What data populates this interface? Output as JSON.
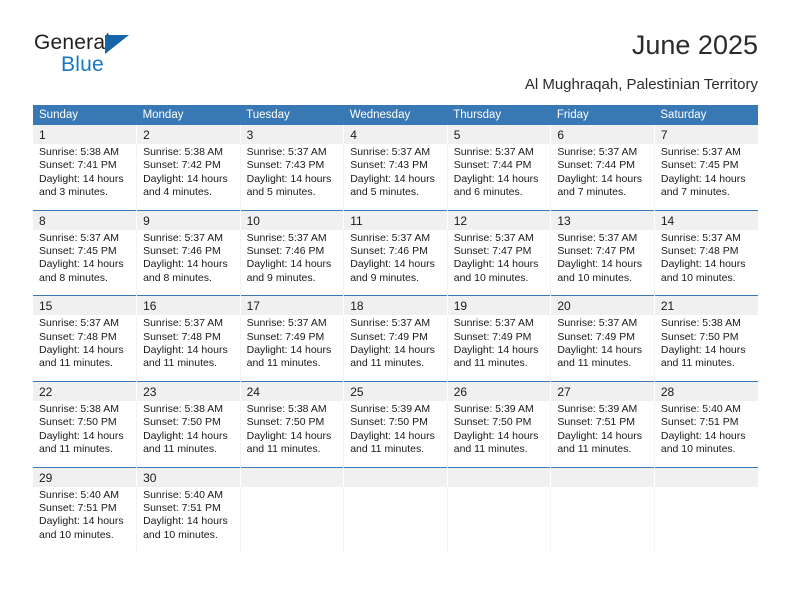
{
  "brand": {
    "name_top": "General",
    "name_bottom": "Blue",
    "accent_color": "#1778c2",
    "triangle_color": "#1565a8"
  },
  "header": {
    "title": "June 2025",
    "subtitle": "Al Mughraqah, Palestinian Territory"
  },
  "calendar": {
    "header_bg": "#3878b4",
    "daynum_bg": "#f0f0f0",
    "weekday_headers": [
      "Sunday",
      "Monday",
      "Tuesday",
      "Wednesday",
      "Thursday",
      "Friday",
      "Saturday"
    ],
    "weeks": [
      [
        {
          "day": "1",
          "sunrise": "Sunrise: 5:38 AM",
          "sunset": "Sunset: 7:41 PM",
          "daylight_1": "Daylight: 14 hours",
          "daylight_2": "and 3 minutes."
        },
        {
          "day": "2",
          "sunrise": "Sunrise: 5:38 AM",
          "sunset": "Sunset: 7:42 PM",
          "daylight_1": "Daylight: 14 hours",
          "daylight_2": "and 4 minutes."
        },
        {
          "day": "3",
          "sunrise": "Sunrise: 5:37 AM",
          "sunset": "Sunset: 7:43 PM",
          "daylight_1": "Daylight: 14 hours",
          "daylight_2": "and 5 minutes."
        },
        {
          "day": "4",
          "sunrise": "Sunrise: 5:37 AM",
          "sunset": "Sunset: 7:43 PM",
          "daylight_1": "Daylight: 14 hours",
          "daylight_2": "and 5 minutes."
        },
        {
          "day": "5",
          "sunrise": "Sunrise: 5:37 AM",
          "sunset": "Sunset: 7:44 PM",
          "daylight_1": "Daylight: 14 hours",
          "daylight_2": "and 6 minutes."
        },
        {
          "day": "6",
          "sunrise": "Sunrise: 5:37 AM",
          "sunset": "Sunset: 7:44 PM",
          "daylight_1": "Daylight: 14 hours",
          "daylight_2": "and 7 minutes."
        },
        {
          "day": "7",
          "sunrise": "Sunrise: 5:37 AM",
          "sunset": "Sunset: 7:45 PM",
          "daylight_1": "Daylight: 14 hours",
          "daylight_2": "and 7 minutes."
        }
      ],
      [
        {
          "day": "8",
          "sunrise": "Sunrise: 5:37 AM",
          "sunset": "Sunset: 7:45 PM",
          "daylight_1": "Daylight: 14 hours",
          "daylight_2": "and 8 minutes."
        },
        {
          "day": "9",
          "sunrise": "Sunrise: 5:37 AM",
          "sunset": "Sunset: 7:46 PM",
          "daylight_1": "Daylight: 14 hours",
          "daylight_2": "and 8 minutes."
        },
        {
          "day": "10",
          "sunrise": "Sunrise: 5:37 AM",
          "sunset": "Sunset: 7:46 PM",
          "daylight_1": "Daylight: 14 hours",
          "daylight_2": "and 9 minutes."
        },
        {
          "day": "11",
          "sunrise": "Sunrise: 5:37 AM",
          "sunset": "Sunset: 7:46 PM",
          "daylight_1": "Daylight: 14 hours",
          "daylight_2": "and 9 minutes."
        },
        {
          "day": "12",
          "sunrise": "Sunrise: 5:37 AM",
          "sunset": "Sunset: 7:47 PM",
          "daylight_1": "Daylight: 14 hours",
          "daylight_2": "and 10 minutes."
        },
        {
          "day": "13",
          "sunrise": "Sunrise: 5:37 AM",
          "sunset": "Sunset: 7:47 PM",
          "daylight_1": "Daylight: 14 hours",
          "daylight_2": "and 10 minutes."
        },
        {
          "day": "14",
          "sunrise": "Sunrise: 5:37 AM",
          "sunset": "Sunset: 7:48 PM",
          "daylight_1": "Daylight: 14 hours",
          "daylight_2": "and 10 minutes."
        }
      ],
      [
        {
          "day": "15",
          "sunrise": "Sunrise: 5:37 AM",
          "sunset": "Sunset: 7:48 PM",
          "daylight_1": "Daylight: 14 hours",
          "daylight_2": "and 11 minutes."
        },
        {
          "day": "16",
          "sunrise": "Sunrise: 5:37 AM",
          "sunset": "Sunset: 7:48 PM",
          "daylight_1": "Daylight: 14 hours",
          "daylight_2": "and 11 minutes."
        },
        {
          "day": "17",
          "sunrise": "Sunrise: 5:37 AM",
          "sunset": "Sunset: 7:49 PM",
          "daylight_1": "Daylight: 14 hours",
          "daylight_2": "and 11 minutes."
        },
        {
          "day": "18",
          "sunrise": "Sunrise: 5:37 AM",
          "sunset": "Sunset: 7:49 PM",
          "daylight_1": "Daylight: 14 hours",
          "daylight_2": "and 11 minutes."
        },
        {
          "day": "19",
          "sunrise": "Sunrise: 5:37 AM",
          "sunset": "Sunset: 7:49 PM",
          "daylight_1": "Daylight: 14 hours",
          "daylight_2": "and 11 minutes."
        },
        {
          "day": "20",
          "sunrise": "Sunrise: 5:37 AM",
          "sunset": "Sunset: 7:49 PM",
          "daylight_1": "Daylight: 14 hours",
          "daylight_2": "and 11 minutes."
        },
        {
          "day": "21",
          "sunrise": "Sunrise: 5:38 AM",
          "sunset": "Sunset: 7:50 PM",
          "daylight_1": "Daylight: 14 hours",
          "daylight_2": "and 11 minutes."
        }
      ],
      [
        {
          "day": "22",
          "sunrise": "Sunrise: 5:38 AM",
          "sunset": "Sunset: 7:50 PM",
          "daylight_1": "Daylight: 14 hours",
          "daylight_2": "and 11 minutes."
        },
        {
          "day": "23",
          "sunrise": "Sunrise: 5:38 AM",
          "sunset": "Sunset: 7:50 PM",
          "daylight_1": "Daylight: 14 hours",
          "daylight_2": "and 11 minutes."
        },
        {
          "day": "24",
          "sunrise": "Sunrise: 5:38 AM",
          "sunset": "Sunset: 7:50 PM",
          "daylight_1": "Daylight: 14 hours",
          "daylight_2": "and 11 minutes."
        },
        {
          "day": "25",
          "sunrise": "Sunrise: 5:39 AM",
          "sunset": "Sunset: 7:50 PM",
          "daylight_1": "Daylight: 14 hours",
          "daylight_2": "and 11 minutes."
        },
        {
          "day": "26",
          "sunrise": "Sunrise: 5:39 AM",
          "sunset": "Sunset: 7:50 PM",
          "daylight_1": "Daylight: 14 hours",
          "daylight_2": "and 11 minutes."
        },
        {
          "day": "27",
          "sunrise": "Sunrise: 5:39 AM",
          "sunset": "Sunset: 7:51 PM",
          "daylight_1": "Daylight: 14 hours",
          "daylight_2": "and 11 minutes."
        },
        {
          "day": "28",
          "sunrise": "Sunrise: 5:40 AM",
          "sunset": "Sunset: 7:51 PM",
          "daylight_1": "Daylight: 14 hours",
          "daylight_2": "and 10 minutes."
        }
      ],
      [
        {
          "day": "29",
          "sunrise": "Sunrise: 5:40 AM",
          "sunset": "Sunset: 7:51 PM",
          "daylight_1": "Daylight: 14 hours",
          "daylight_2": "and 10 minutes."
        },
        {
          "day": "30",
          "sunrise": "Sunrise: 5:40 AM",
          "sunset": "Sunset: 7:51 PM",
          "daylight_1": "Daylight: 14 hours",
          "daylight_2": "and 10 minutes."
        },
        {
          "day": "",
          "sunrise": "",
          "sunset": "",
          "daylight_1": "",
          "daylight_2": ""
        },
        {
          "day": "",
          "sunrise": "",
          "sunset": "",
          "daylight_1": "",
          "daylight_2": ""
        },
        {
          "day": "",
          "sunrise": "",
          "sunset": "",
          "daylight_1": "",
          "daylight_2": ""
        },
        {
          "day": "",
          "sunrise": "",
          "sunset": "",
          "daylight_1": "",
          "daylight_2": ""
        },
        {
          "day": "",
          "sunrise": "",
          "sunset": "",
          "daylight_1": "",
          "daylight_2": ""
        }
      ]
    ]
  }
}
